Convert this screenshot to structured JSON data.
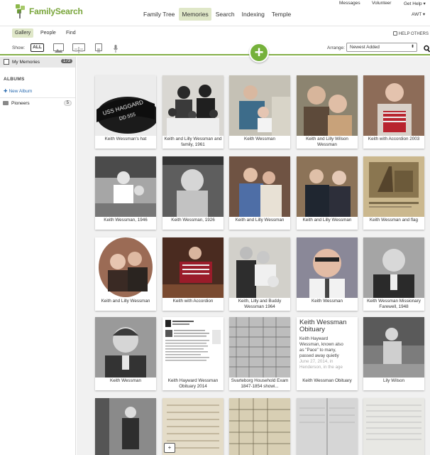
{
  "header": {
    "logo_text": "FamilySearch",
    "utility": {
      "messages": "Messages",
      "volunteer": "Volunteer",
      "help": "Get Help ▾",
      "user": "AWT ▾"
    },
    "nav": [
      {
        "label": "Family Tree",
        "active": false
      },
      {
        "label": "Memories",
        "active": true
      },
      {
        "label": "Search",
        "active": false
      },
      {
        "label": "Indexing",
        "active": false
      },
      {
        "label": "Temple",
        "active": false
      }
    ]
  },
  "subnav": {
    "tabs": [
      {
        "label": "Gallery",
        "active": true
      },
      {
        "label": "People",
        "active": false
      },
      {
        "label": "Find",
        "active": false
      }
    ],
    "help_others": "HELP OTHERS"
  },
  "toolbar": {
    "show_label": "Show:",
    "filter_all": "ALL",
    "filter_icons": [
      "photo-filter-icon",
      "story-filter-icon",
      "document-filter-icon",
      "audio-filter-icon"
    ],
    "arrange_label": "Arrange:",
    "arrange_value": "Newest Added",
    "add_label": "+"
  },
  "sidebar": {
    "my_memories": "My Memories",
    "my_memories_count": "173",
    "albums_heading": "ALBUMS",
    "new_album": "New Album",
    "albums": [
      {
        "label": "Pioneers",
        "count": "5"
      }
    ]
  },
  "gallery": {
    "captions": [
      "Keith Wessman's hat",
      "Keith and Lilly Wessman and family, 1961",
      "Keith Wessman",
      "Keith and Lilly Wilson Wessman",
      "Keith with Accordion 2003",
      "Keith Wessman, 1946",
      "Keith Wessman, 1926",
      "Keith and Lilly Wessman",
      "Keith and Lilly Wessman",
      "Keith Wessman and flag",
      "Keith and Lilly Wessman",
      "Keith with Accordion",
      "Keith, Lilly and Buddy Wessman 1964",
      "Keith Wessman",
      "Keith Wessman Missionary Farewell, 1948",
      "Keith Wessman",
      "Keith Hayward Wessman Obituary 2014",
      "Svarteborg Household Exam 1847-1854 showi...",
      "Keith Wessman Obituary",
      "Lily Wilson"
    ],
    "hat_text_1": "USS HAGGARD",
    "hat_text_2": "DD 555",
    "obituary": {
      "title": "Keith Wessman Obituary",
      "line1": "Keith Hayward",
      "line2": "Wessman, known also",
      "line3": "as \"Pace\" to many,",
      "line4": "passed away quietly",
      "line5": "June 27, 2014, in",
      "line6": "Henderson, in the age"
    }
  },
  "colors": {
    "brand_green": "#7aa63c",
    "active_tab": "#dfe7c8",
    "add_button": "#75b13b"
  }
}
